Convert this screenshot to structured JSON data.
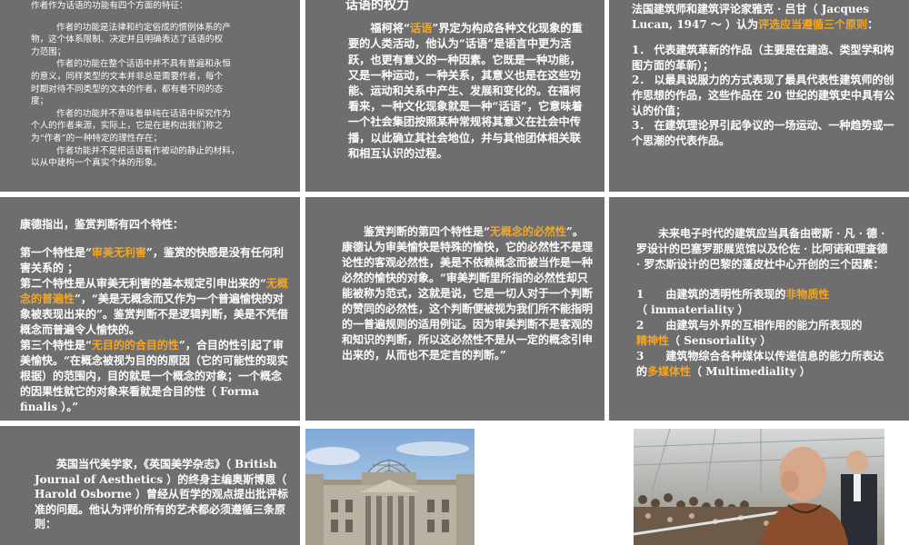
{
  "panel1": {
    "lines": [
      "作者作为话语的功能有四个方面的特征：",
      "",
      "作者的功能是法律和约定俗成的惯例体系的产",
      "物，这个体系限制、决定并且明确表达了话语的权",
      "力范围；",
      "作者的功能在整个话语中并不具有普遍和永恒",
      "的意义，同样类型的文本并非总是需要作者，每个",
      "时期对待不同类型的文本的作者，都有着不同的态",
      "度；",
      "作者的功能并不意味着单纯在话语中探究作为",
      "个人的作者来源，实际上，它是在建构出我们称之",
      "为“作者”的一种特定的理性存在；",
      "作者功能并不是把话语看作被动的静止的材料，",
      "以从中建构一个真实个体的形象。"
    ]
  },
  "panel2": {
    "title": "话语的权力",
    "p_a": "福柯将“",
    "p_hl": "话语",
    "p_b": "”界定为构成各种文化现象的重要的人类活动，他认为“话语”是语言中更为活跃，也更有意义的一种因素。它既是一种功能，又是一种运动，一种关系，其意义也是在这些功能、运动和关系中产生、发展和变化的。在福柯看来，一种文化现象就是一种“话语”，它意味着一个社会集团按照某种常规将其意义在社会中传播，以此确立其社会地位，并与其他团体相关联和相互认识的过程。"
  },
  "panel3": {
    "intro_a": "法国建筑师和建筑评论家雅克 · 吕甘（ Jacques Lucan, 1947 ～ ）认为",
    "intro_hl": "评选应当遵循三个原则",
    "intro_b": "：",
    "items": [
      "1． 代表建筑革新的作品（主要是在建造、类型学和构图方面的革新）；",
      "2． 以最具说服力的方式表现了最具代表性建筑师的创作思想的作品，这些作品在 20 世纪的建筑史中具有公认的价值；",
      "3． 在建筑理论界引起争议的一场运动、一种趋势或一个思潮的代表作品。"
    ]
  },
  "panel4": {
    "intro": "康德指出，鉴赏判断有四个特性：",
    "s1_a": "第一个特性是“",
    "s1_hl": "审美无利害",
    "s1_b": "”，鉴赏的快感是没有任何利害关系的 ；",
    "s2_a": "第二个特性是从审美无利害的基本规定引申出来的“",
    "s2_hl": "无概念的普遍性",
    "s2_b": "”，“美是无概念而又作为一个普遍愉快的对象被表现出来的”。鉴赏判断不是逻辑判断，美是不凭借概念而普遍令人愉快的。",
    "s3_a": "第三个特性是“",
    "s3_hl": "无目的的合目的性",
    "s3_b": "”，合目的性引起了审美愉快。“在概念被视为目的的原因（它的可能性的现实根据）的范围内，目的就是一个概念的对象；一个概念的因果性就它的对象来看就是合目的性（ Forma finalis ）。”"
  },
  "panel5": {
    "p_a": "鉴赏判断的第四个特性是“",
    "p_hl": "无概念的必然性",
    "p_b": "”。康德认为审美愉快是特殊的愉快，它的必然性不是理论性的客观必然性，美是不依赖概念而被当作是一种必然的愉快的对象。“审美判断里所指的必然性却只能被称为范式，这就是说，它是一切人对于一个判断的赞同的必然性，这个判断便被视为我们所不能指明的一普遍规则的适用例证。因为审美判断不是客观的和知识的判断，所以这必然性不是从一定的概念引申出来的，从而也不是定言的判断。”"
  },
  "panel6": {
    "intro": "未来电子时代的建筑应当具备由密斯 · 凡 · 德 · 罗设计的巴塞罗那展览馆以及伦佐 · 比阿诺和理查德 · 罗杰斯设计的巴黎的蓬皮杜中心开创的三个因素：",
    "f1_a": "1　　由建筑的透明性所表现的",
    "f1_hl": "非物质性",
    "f1_b": "（ immateriality ）",
    "f2_a": "2　　由建筑与外界的互相作用的能力所表现的",
    "f2_hl": "精神性",
    "f2_b": "（ Sensoriality ）",
    "f3_a": "3　　建筑物综合各种媒体以传递信息的能力所表达的",
    "f3_hl": "多媒体性",
    "f3_b": "（ Multimediality ）"
  },
  "panel7": {
    "text": "英国当代美学家，《英国美学杂志》（ British Journal of Aesthetics ）的终身主编奥斯博恩（ Harold Osborne ）曾经从哲学的观点提出批评标准的问题。他认为评价所有的艺术都必须遵循三条原则："
  },
  "colors": {
    "panel_bg": "#6e6e6e",
    "highlight": "#f5a623",
    "text": "#ffffff"
  },
  "images": [
    "reichstag-dome-photo",
    "architect-portrait-photo"
  ]
}
